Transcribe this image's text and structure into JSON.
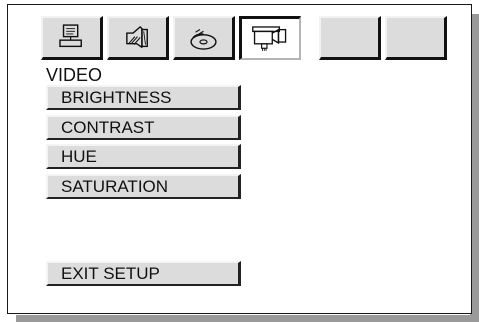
{
  "screen": {
    "title": "VIDEO",
    "tabs": [
      {
        "icon": "monitor-icon",
        "active": false
      },
      {
        "icon": "audio-speaker-icon",
        "active": false
      },
      {
        "icon": "disc-icon",
        "active": false
      },
      {
        "icon": "video-camera-icon",
        "active": true
      },
      {
        "icon": "",
        "active": false
      },
      {
        "icon": "",
        "active": false
      }
    ],
    "items": [
      {
        "label": "BRIGHTNESS"
      },
      {
        "label": "CONTRAST"
      },
      {
        "label": "HUE"
      },
      {
        "label": "SATURATION"
      }
    ],
    "exit_label": "EXIT SETUP"
  },
  "colors": {
    "button_face": "#dcdcdc",
    "panel_bg": "#ffffff",
    "shadow": "#9a9a9a",
    "text": "#111111"
  }
}
